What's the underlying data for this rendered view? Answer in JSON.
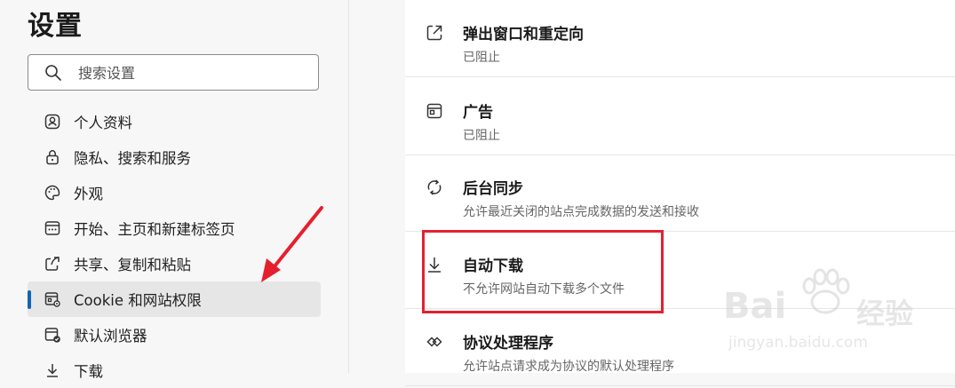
{
  "sidebar": {
    "title": "设置",
    "search_placeholder": "搜索设置",
    "items": [
      {
        "label": "个人资料",
        "icon": "profile-icon"
      },
      {
        "label": "隐私、搜索和服务",
        "icon": "lock-icon"
      },
      {
        "label": "外观",
        "icon": "palette-icon"
      },
      {
        "label": "开始、主页和新建标签页",
        "icon": "home-tab-icon"
      },
      {
        "label": "共享、复制和粘贴",
        "icon": "share-icon"
      },
      {
        "label": "Cookie 和网站权限",
        "icon": "cookie-permissions-icon",
        "active": true
      },
      {
        "label": "默认浏览器",
        "icon": "default-browser-icon"
      },
      {
        "label": "下载",
        "icon": "download-icon"
      }
    ]
  },
  "permissions": [
    {
      "title": "弹出窗口和重定向",
      "subtitle": "已阻止",
      "icon": "popup-redirect-icon"
    },
    {
      "title": "广告",
      "subtitle": "已阻止",
      "icon": "ads-icon"
    },
    {
      "title": "后台同步",
      "subtitle": "允许最近关闭的站点完成数据的发送和接收",
      "icon": "sync-icon"
    },
    {
      "title": "自动下载",
      "subtitle": "不允许网站自动下载多个文件",
      "icon": "download-icon"
    },
    {
      "title": "协议处理程序",
      "subtitle": "允许站点请求成为协议的默认处理程序",
      "icon": "protocol-handler-icon"
    }
  ],
  "watermark": {
    "brand": "Bai",
    "brand_suffix": "经验",
    "url": "jingyan.baidu.com"
  },
  "colors": {
    "accent": "#1264b6",
    "highlight": "#e5202e",
    "sidebar_bg": "#f7f7f7",
    "content_bg": "#ffffff"
  }
}
